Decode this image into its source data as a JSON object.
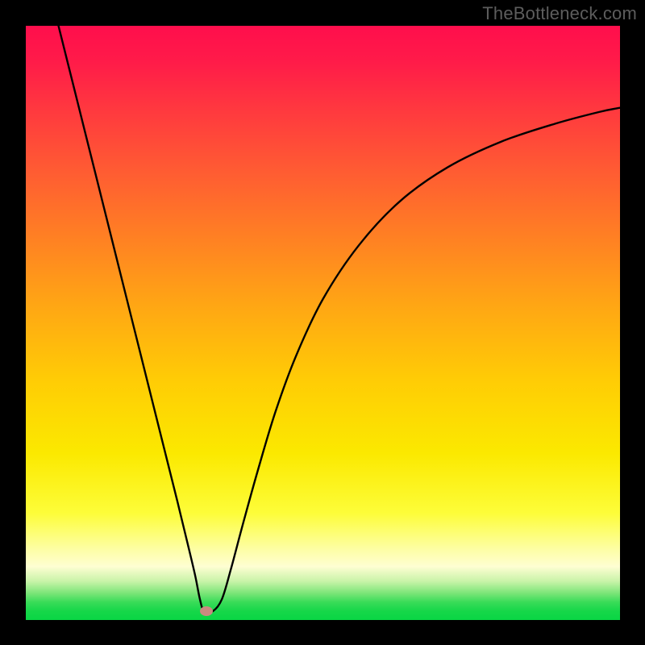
{
  "watermark": "TheBottleneck.com",
  "marker": {
    "x_frac": 0.304,
    "y_frac": 0.985,
    "color": "#ca8a80"
  },
  "chart_data": {
    "type": "line",
    "title": "",
    "xlabel": "",
    "ylabel": "",
    "xlim": [
      0,
      1
    ],
    "ylim": [
      0,
      1
    ],
    "series": [
      {
        "name": "bottleneck-curve",
        "x": [
          0.055,
          0.08,
          0.105,
          0.13,
          0.155,
          0.18,
          0.205,
          0.23,
          0.255,
          0.272,
          0.285,
          0.293,
          0.3,
          0.315,
          0.33,
          0.345,
          0.365,
          0.39,
          0.42,
          0.455,
          0.5,
          0.56,
          0.63,
          0.71,
          0.8,
          0.89,
          0.965,
          1.0
        ],
        "y": [
          1.0,
          0.9,
          0.8,
          0.7,
          0.6,
          0.5,
          0.4,
          0.3,
          0.2,
          0.13,
          0.075,
          0.035,
          0.015,
          0.015,
          0.035,
          0.085,
          0.16,
          0.25,
          0.35,
          0.445,
          0.54,
          0.63,
          0.705,
          0.762,
          0.805,
          0.835,
          0.855,
          0.862
        ]
      }
    ],
    "annotations": [
      {
        "name": "minimum-marker",
        "x": 0.304,
        "y": 0.015
      }
    ],
    "background": "vertical-rainbow-gradient (red→orange→yellow→green)"
  }
}
